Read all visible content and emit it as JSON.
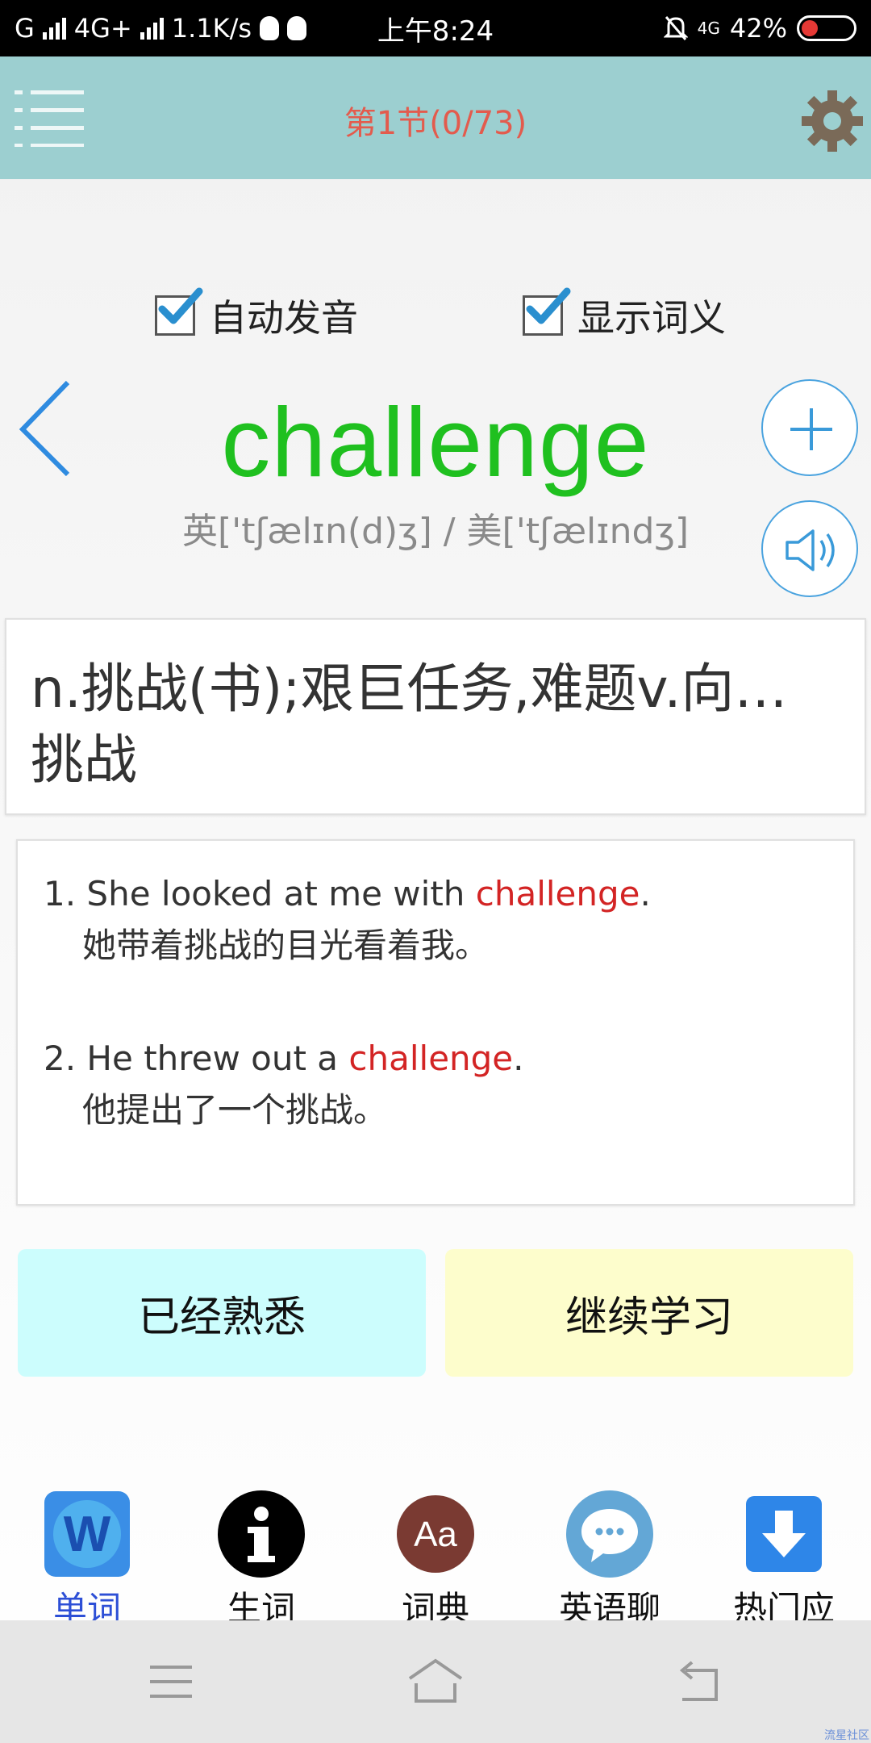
{
  "status_bar": {
    "network": "G",
    "network2": "4G+",
    "speed": "1.1K/s",
    "time": "上午8:24",
    "data_type": "4G",
    "battery": "42%"
  },
  "header": {
    "title": "第1节(0/73)"
  },
  "options": {
    "auto_pronounce": {
      "label": "自动发音",
      "checked": true
    },
    "show_meaning": {
      "label": "显示词义",
      "checked": true
    }
  },
  "word": {
    "text": "challenge",
    "phonetic": "英['tʃælɪn(d)ʒ]  /  美['tʃælɪndʒ]"
  },
  "definition": "n.挑战(书);艰巨任务,难题v.向…挑战",
  "examples": [
    {
      "number": "1.",
      "before": " She looked at me with ",
      "keyword": "challenge",
      "after": ".",
      "translation": "她带着挑战的目光看着我。"
    },
    {
      "number": "2.",
      "before": " He threw out a ",
      "keyword": "challenge",
      "after": ".",
      "translation": "他提出了一个挑战。"
    }
  ],
  "actions": {
    "familiar": "已经熟悉",
    "continue": "继续学习"
  },
  "tabs": [
    {
      "label": "单词",
      "icon": "word-app-icon",
      "active": true
    },
    {
      "label": "生词",
      "icon": "info-icon",
      "active": false
    },
    {
      "label": "词典",
      "icon": "dictionary-icon",
      "active": false
    },
    {
      "label": "英语聊天",
      "icon": "chat-icon",
      "active": false
    },
    {
      "label": "热门应用",
      "icon": "download-icon",
      "active": false
    }
  ],
  "watermark": "流星社区",
  "colors": {
    "header_bg": "#9ccfd0",
    "title": "#e35b4d",
    "word": "#1fc01f",
    "highlight": "#d32424",
    "familiar_bg": "#ccfdfd",
    "continue_bg": "#fdfdcc",
    "active_tab": "#2d4fd6"
  }
}
